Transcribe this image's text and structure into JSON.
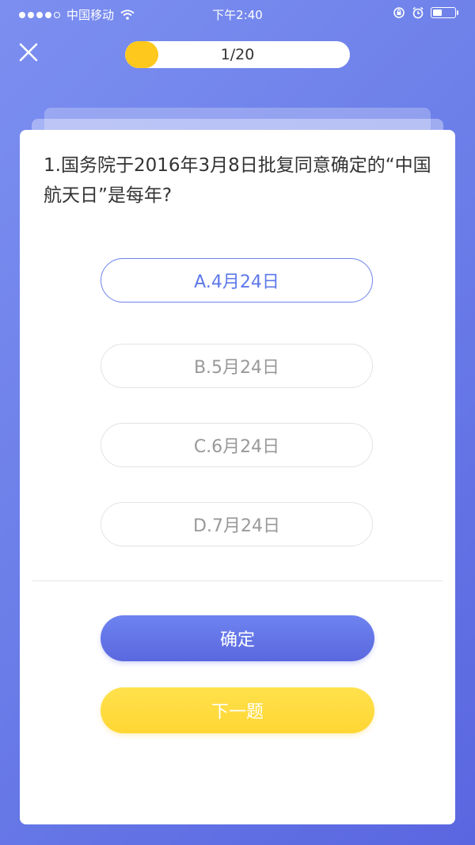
{
  "status_bar": {
    "carrier": "中国移动",
    "time": "下午2:40",
    "signal_filled": 4,
    "signal_total": 5,
    "battery_level": 0.45
  },
  "header": {
    "close_icon": "close-icon",
    "progress_text": "1/20",
    "progress_fraction": 0.05
  },
  "question": {
    "text": "1.国务院于2016年3月8日批复同意确定的“中国航天日”是每年?"
  },
  "options": [
    {
      "label": "A.4月24日",
      "selected": true
    },
    {
      "label": "B.5月24日",
      "selected": false
    },
    {
      "label": "C.6月24日",
      "selected": false
    },
    {
      "label": "D.7月24日",
      "selected": false
    }
  ],
  "buttons": {
    "confirm_label": "确定",
    "next_label": "下一题"
  },
  "colors": {
    "background": "#6a7de8",
    "accent": "#5d78ea",
    "progress": "#ffc81c",
    "next_button": "#ffd633"
  }
}
